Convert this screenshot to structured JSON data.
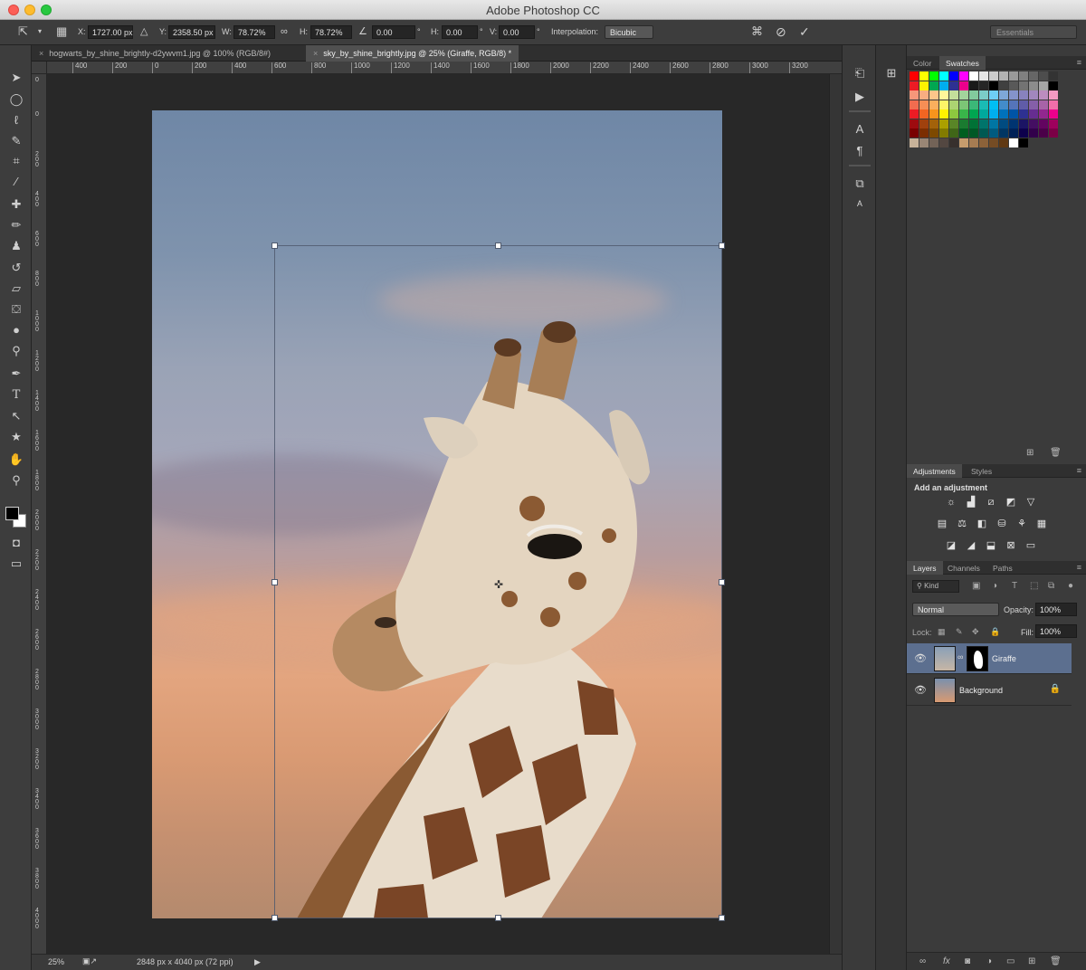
{
  "app": {
    "title": "Adobe Photoshop CC"
  },
  "options": {
    "x_label": "X:",
    "x_value": "1727.00 px",
    "y_label": "Y:",
    "y_value": "2358.50 px",
    "w_label": "W:",
    "w_value": "78.72%",
    "h_label": "H:",
    "h_value": "78.72%",
    "angle_value": "0.00",
    "hskew_label": "H:",
    "hskew_value": "0.00",
    "vskew_label": "V:",
    "vskew_value": "0.00",
    "interp_label": "Interpolation:",
    "interp_value": "Bicubic",
    "workspace": "Essentials"
  },
  "tabs": [
    {
      "label": "hogwarts_by_shine_brightly-d2ywvm1.jpg @ 100% (RGB/8#)"
    },
    {
      "label": "sky_by_shine_brightly.jpg @ 25% (Giraffe, RGB/8) *"
    }
  ],
  "ruler": {
    "h_ticks": [
      "400",
      "200",
      "0",
      "200",
      "400",
      "600",
      "800",
      "1000",
      "1200",
      "1400",
      "1600",
      "1800",
      "2000",
      "2200",
      "2400",
      "2600",
      "2800",
      "3000",
      "3200"
    ],
    "v_ticks": [
      "0",
      "0",
      "200",
      "400",
      "600",
      "800",
      "1000",
      "1200",
      "1400",
      "1600",
      "1800",
      "2000",
      "2200",
      "2400",
      "2600",
      "2800",
      "3000",
      "3200",
      "3400",
      "3600",
      "3800",
      "4000"
    ]
  },
  "status": {
    "zoom": "25%",
    "doc_info": "2848 px x 4040 px (72 ppi)"
  },
  "panels": {
    "top_tabs": [
      "Color",
      "Swatches"
    ],
    "adjust_tabs": [
      "Adjustments",
      "Styles"
    ],
    "adjust_title": "Add an adjustment",
    "layer_tabs": [
      "Layers",
      "Channels",
      "Paths"
    ],
    "filter_kind": "Kind",
    "blend_mode": "Normal",
    "opacity_label": "Opacity:",
    "opacity_value": "100%",
    "lock_label": "Lock:",
    "fill_label": "Fill:",
    "fill_value": "100%"
  },
  "layers": [
    {
      "name": "Giraffe",
      "selected": true
    },
    {
      "name": "Background",
      "selected": false
    }
  ],
  "colors": {
    "selection": "#5c6f8f",
    "panel_bg": "#3b3b3b"
  }
}
